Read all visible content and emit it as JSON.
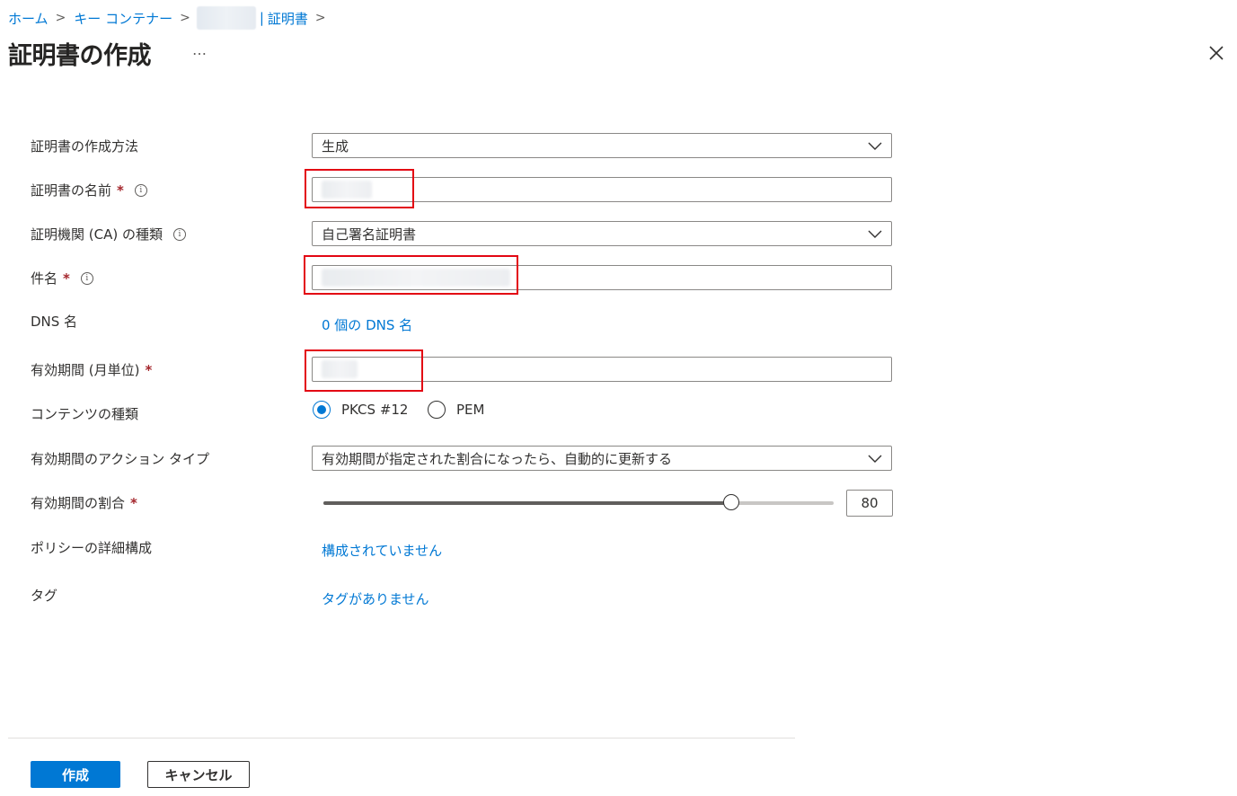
{
  "breadcrumb": {
    "home": "ホーム",
    "key_vault": "キー コンテナー",
    "separator": ">",
    "pipe": "|",
    "certificates": "証明書"
  },
  "header": {
    "title": "証明書の作成",
    "more": "…"
  },
  "form": {
    "method_label": "証明書の作成方法",
    "method_value": "生成",
    "name_label": "証明書の名前",
    "ca_label": "証明機関 (CA) の種類",
    "ca_value": "自己署名証明書",
    "subject_label": "件名",
    "dns_label": "DNS 名",
    "dns_link": "0 個の DNS 名",
    "validity_label": "有効期間 (月単位)",
    "content_type_label": "コンテンツの種類",
    "content_type_options": [
      "PKCS #12",
      "PEM"
    ],
    "content_type_selected": "PKCS #12",
    "action_label": "有効期間のアクション タイプ",
    "action_value": "有効期間が指定された割合になったら、自動的に更新する",
    "percent_label": "有効期間の割合",
    "percent_value": "80",
    "percent_fraction": 0.8,
    "policy_label": "ポリシーの詳細構成",
    "policy_link": "構成されていません",
    "tags_label": "タグ",
    "tags_link": "タグがありません",
    "required_mark": "*",
    "info_glyph": "i"
  },
  "footer": {
    "create_label": "作成",
    "cancel_label": "キャンセル"
  },
  "colors": {
    "accent": "#0078d4",
    "required": "#a4262c",
    "highlight_box": "#e30613"
  }
}
